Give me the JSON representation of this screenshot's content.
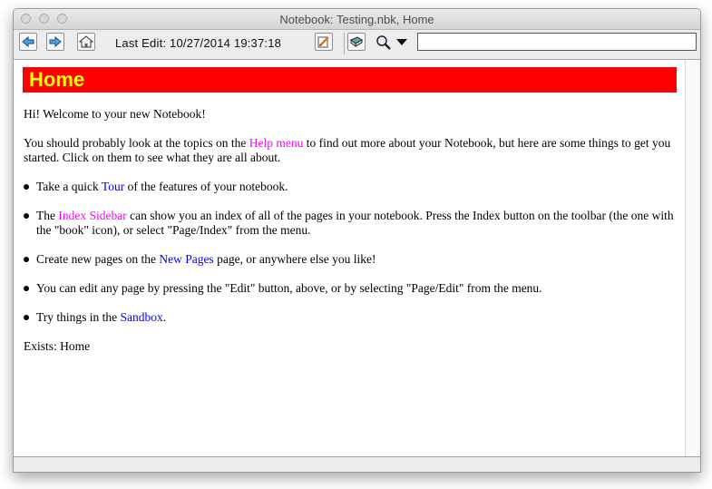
{
  "window": {
    "title": "Notebook: Testing.nbk, Home"
  },
  "toolbar": {
    "last_edit": "Last Edit: 10/27/2014 19:37:18",
    "search_value": ""
  },
  "page": {
    "heading": "Home",
    "greeting": "Hi! Welcome to your new Notebook!",
    "intro": {
      "before": "You should probably look at the topics on the ",
      "link": "Help menu",
      "after": " to find out more about your Notebook, but here are some things to get you started.  Click on them to see what they are all about."
    },
    "items": [
      {
        "before": "Take a quick ",
        "link": "Tour",
        "after": " of the features of your notebook."
      },
      {
        "before": "The ",
        "link": "Index Sidebar",
        "after": " can show you an index of all of the pages in your notebook.  Press the Index button on the toolbar (the one with the \"book\" icon), or select \"Page/Index\" from the menu."
      },
      {
        "before": "Create new pages on the ",
        "link": "New Pages",
        "after": " page, or anywhere else you like!"
      },
      {
        "text": "You can edit any page by pressing the \"Edit\" button, above, or by selecting \"Page/Edit\" from the menu."
      },
      {
        "before": "Try things in the ",
        "link": "Sandbox",
        "after": "."
      }
    ],
    "exists": "Exists: Home"
  },
  "colors": {
    "heading_bg": "#ff0000",
    "heading_text": "#ffff00",
    "link_existing_page": "#0000ff",
    "link_other": "#ff00ff"
  },
  "icons": [
    "back-arrow-icon",
    "forward-arrow-icon",
    "home-icon",
    "edit-pencil-icon",
    "book-index-icon",
    "magnifier-icon",
    "dropdown-triangle-icon"
  ]
}
